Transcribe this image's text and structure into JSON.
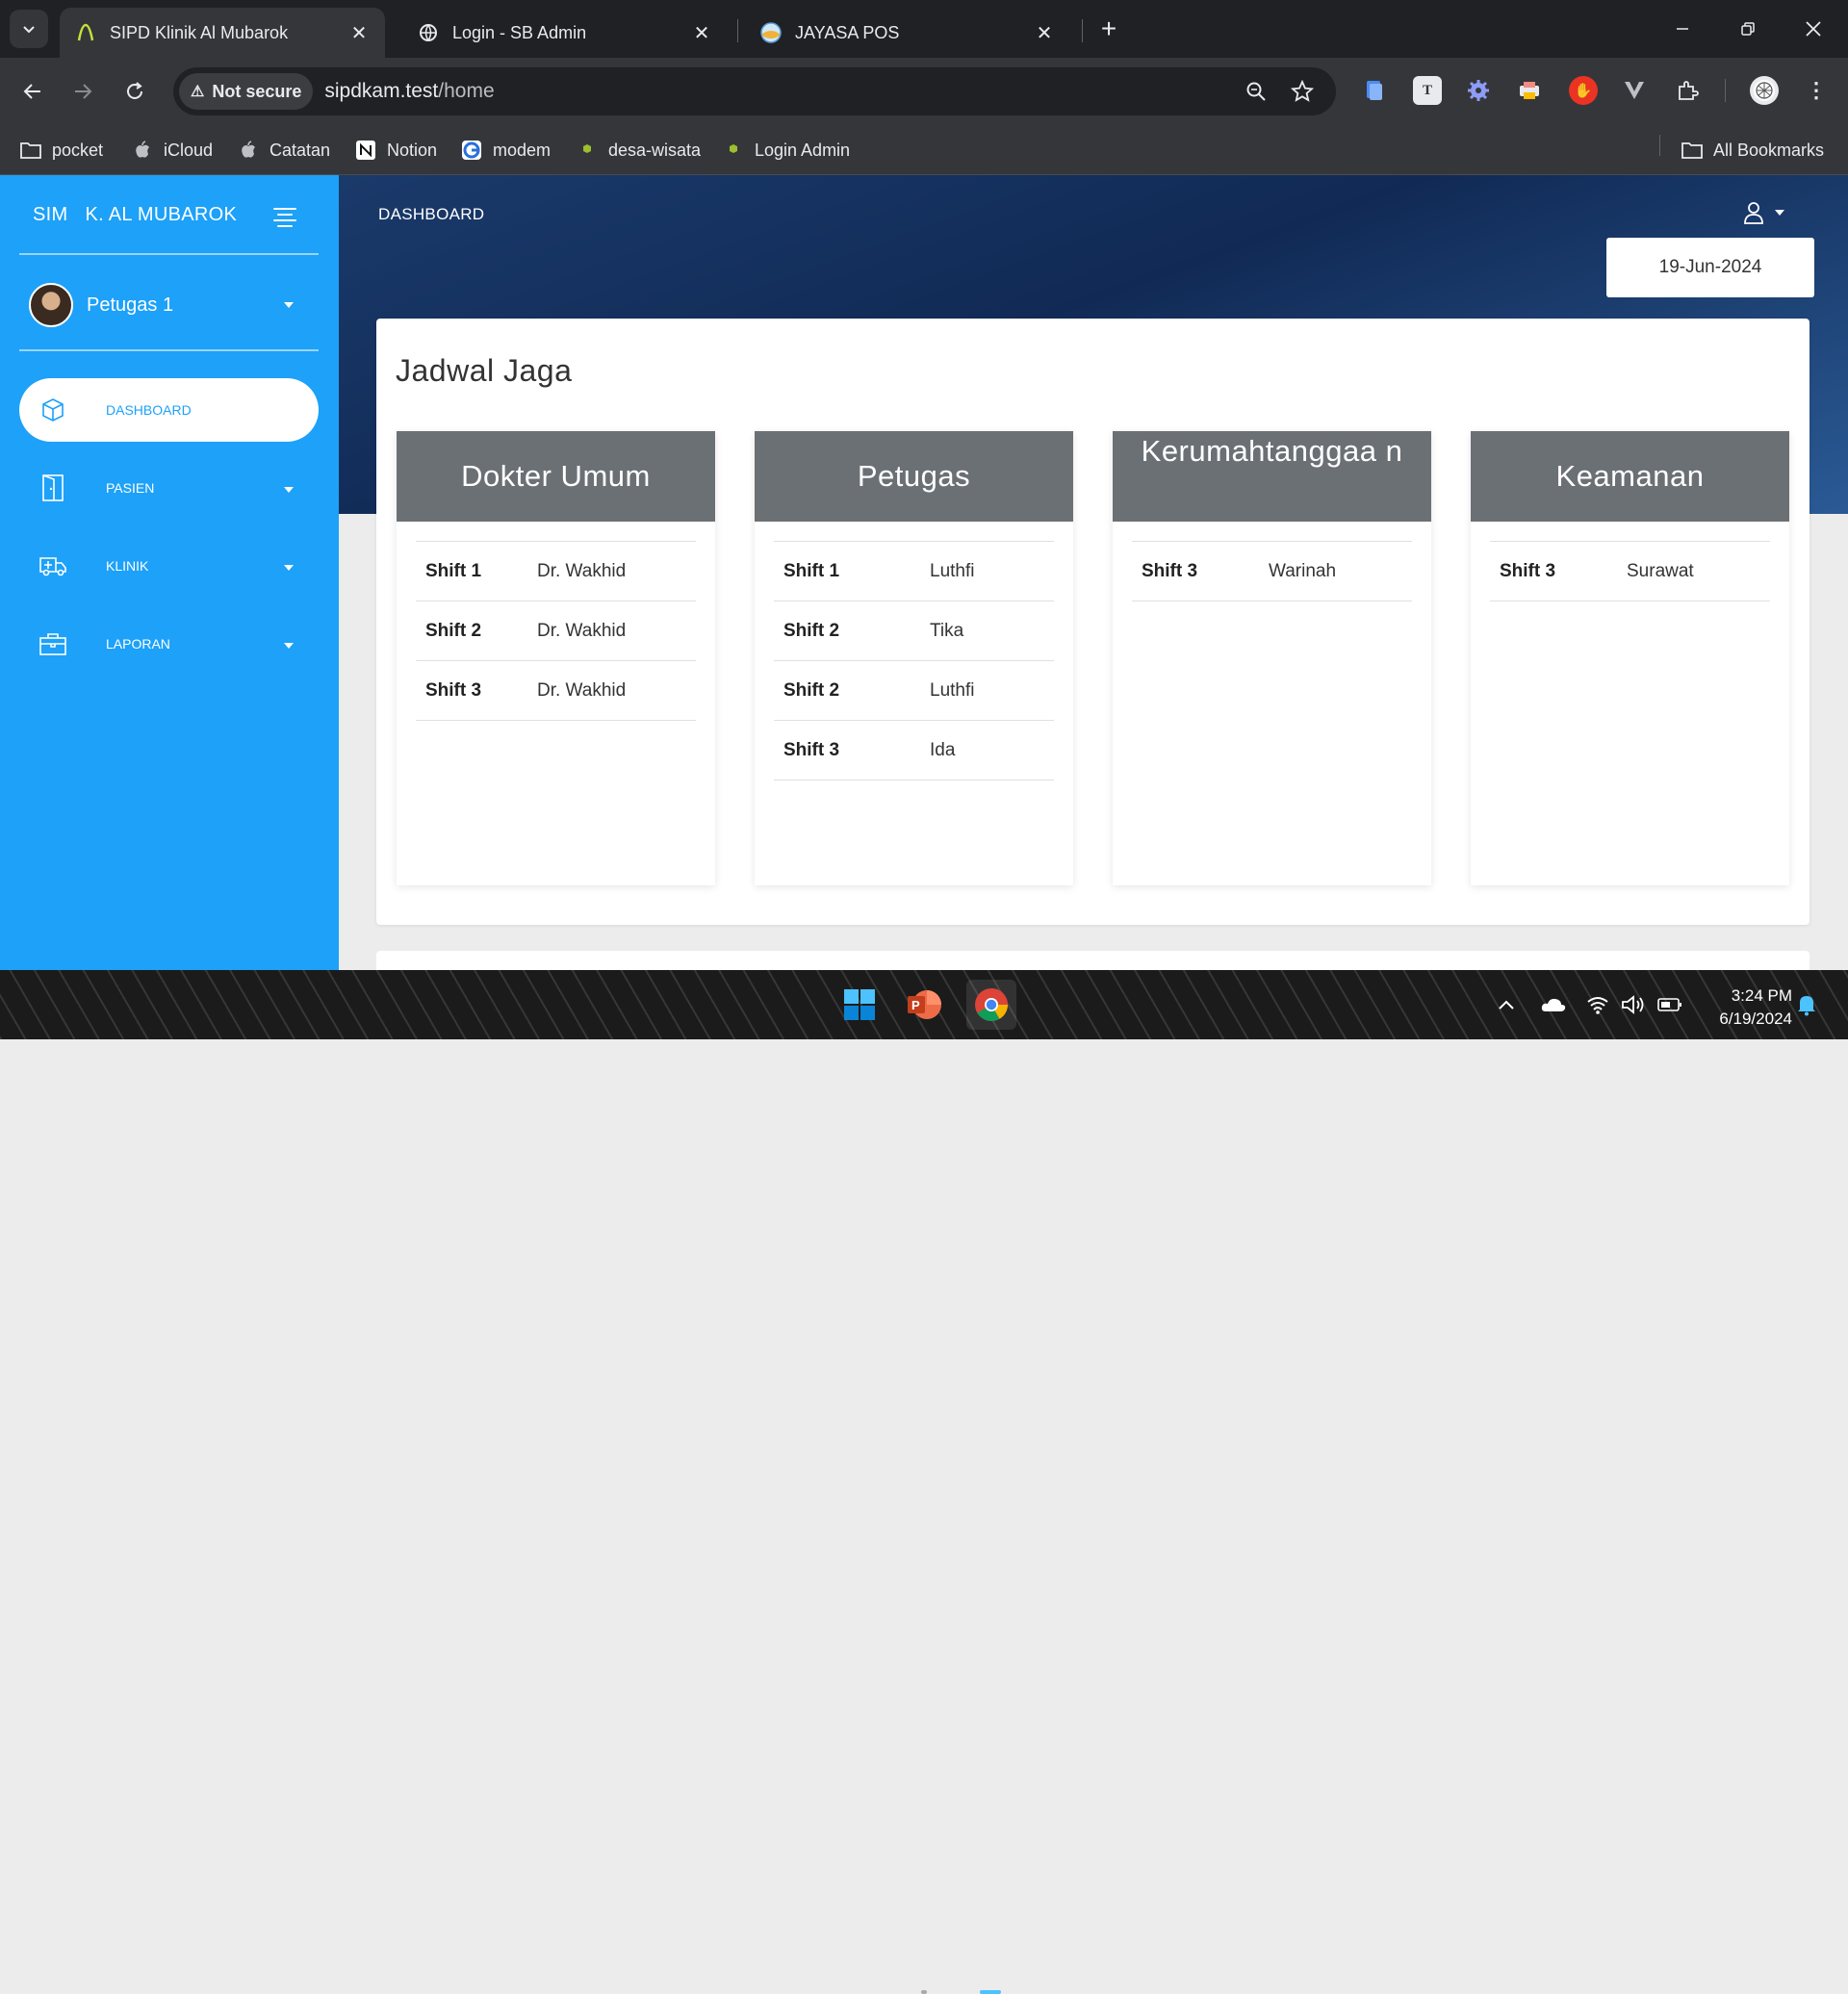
{
  "browser": {
    "tabs": [
      {
        "title": "SIPD Klinik Al Mubarok",
        "active": true
      },
      {
        "title": "Login - SB Admin",
        "active": false
      },
      {
        "title": "JAYASA POS",
        "active": false
      }
    ],
    "security_label": "Not secure",
    "url_host": "sipdkam.test",
    "url_path": "/home",
    "bookmarks": [
      {
        "label": "pocket",
        "icon": "folder-icon"
      },
      {
        "label": "iCloud",
        "icon": "apple-icon"
      },
      {
        "label": "Catatan",
        "icon": "apple-icon"
      },
      {
        "label": "Notion",
        "icon": "notion-icon"
      },
      {
        "label": "modem",
        "icon": "modem-icon"
      },
      {
        "label": "desa-wisata",
        "icon": "laravel-icon"
      },
      {
        "label": "Login Admin",
        "icon": "laravel-icon"
      }
    ],
    "all_bookmarks_label": "All Bookmarks"
  },
  "sidebar": {
    "brand_short": "SIM",
    "brand_name": "K. AL MUBAROK",
    "user_name": "Petugas 1",
    "menu": [
      {
        "label": "DASHBOARD",
        "icon": "cube-icon",
        "active": true
      },
      {
        "label": "PASIEN",
        "icon": "door-icon",
        "active": false
      },
      {
        "label": "KLINIK",
        "icon": "ambulance-icon",
        "active": false
      },
      {
        "label": "LAPORAN",
        "icon": "briefcase-icon",
        "active": false
      }
    ]
  },
  "header": {
    "page_label": "DASHBOARD",
    "date": "19-Jun-2024"
  },
  "schedule": {
    "title": "Jadwal Jaga",
    "cards": [
      {
        "title": "Dokter Umum",
        "rows": [
          {
            "shift": "Shift 1",
            "name": "Dr. Wakhid"
          },
          {
            "shift": "Shift 2",
            "name": "Dr. Wakhid"
          },
          {
            "shift": "Shift 3",
            "name": "Dr. Wakhid"
          }
        ]
      },
      {
        "title": "Petugas",
        "rows": [
          {
            "shift": "Shift 1",
            "name": "Luthfi"
          },
          {
            "shift": "Shift 2",
            "name": "Tika"
          },
          {
            "shift": "Shift 2",
            "name": "Luthfi"
          },
          {
            "shift": "Shift 3",
            "name": "Ida"
          }
        ]
      },
      {
        "title": "Kerumahtanggaa n",
        "rows": [
          {
            "shift": "Shift 3",
            "name": "Warinah"
          }
        ]
      },
      {
        "title": "Keamanan",
        "rows": [
          {
            "shift": "Shift 3",
            "name": "Surawat"
          }
        ]
      }
    ]
  },
  "taskbar": {
    "time": "3:24 PM",
    "date": "6/19/2024"
  },
  "colors": {
    "sidebar": "#1da1f9",
    "card_header": "#6b7075",
    "header_gradient_dark": "#112a55"
  }
}
